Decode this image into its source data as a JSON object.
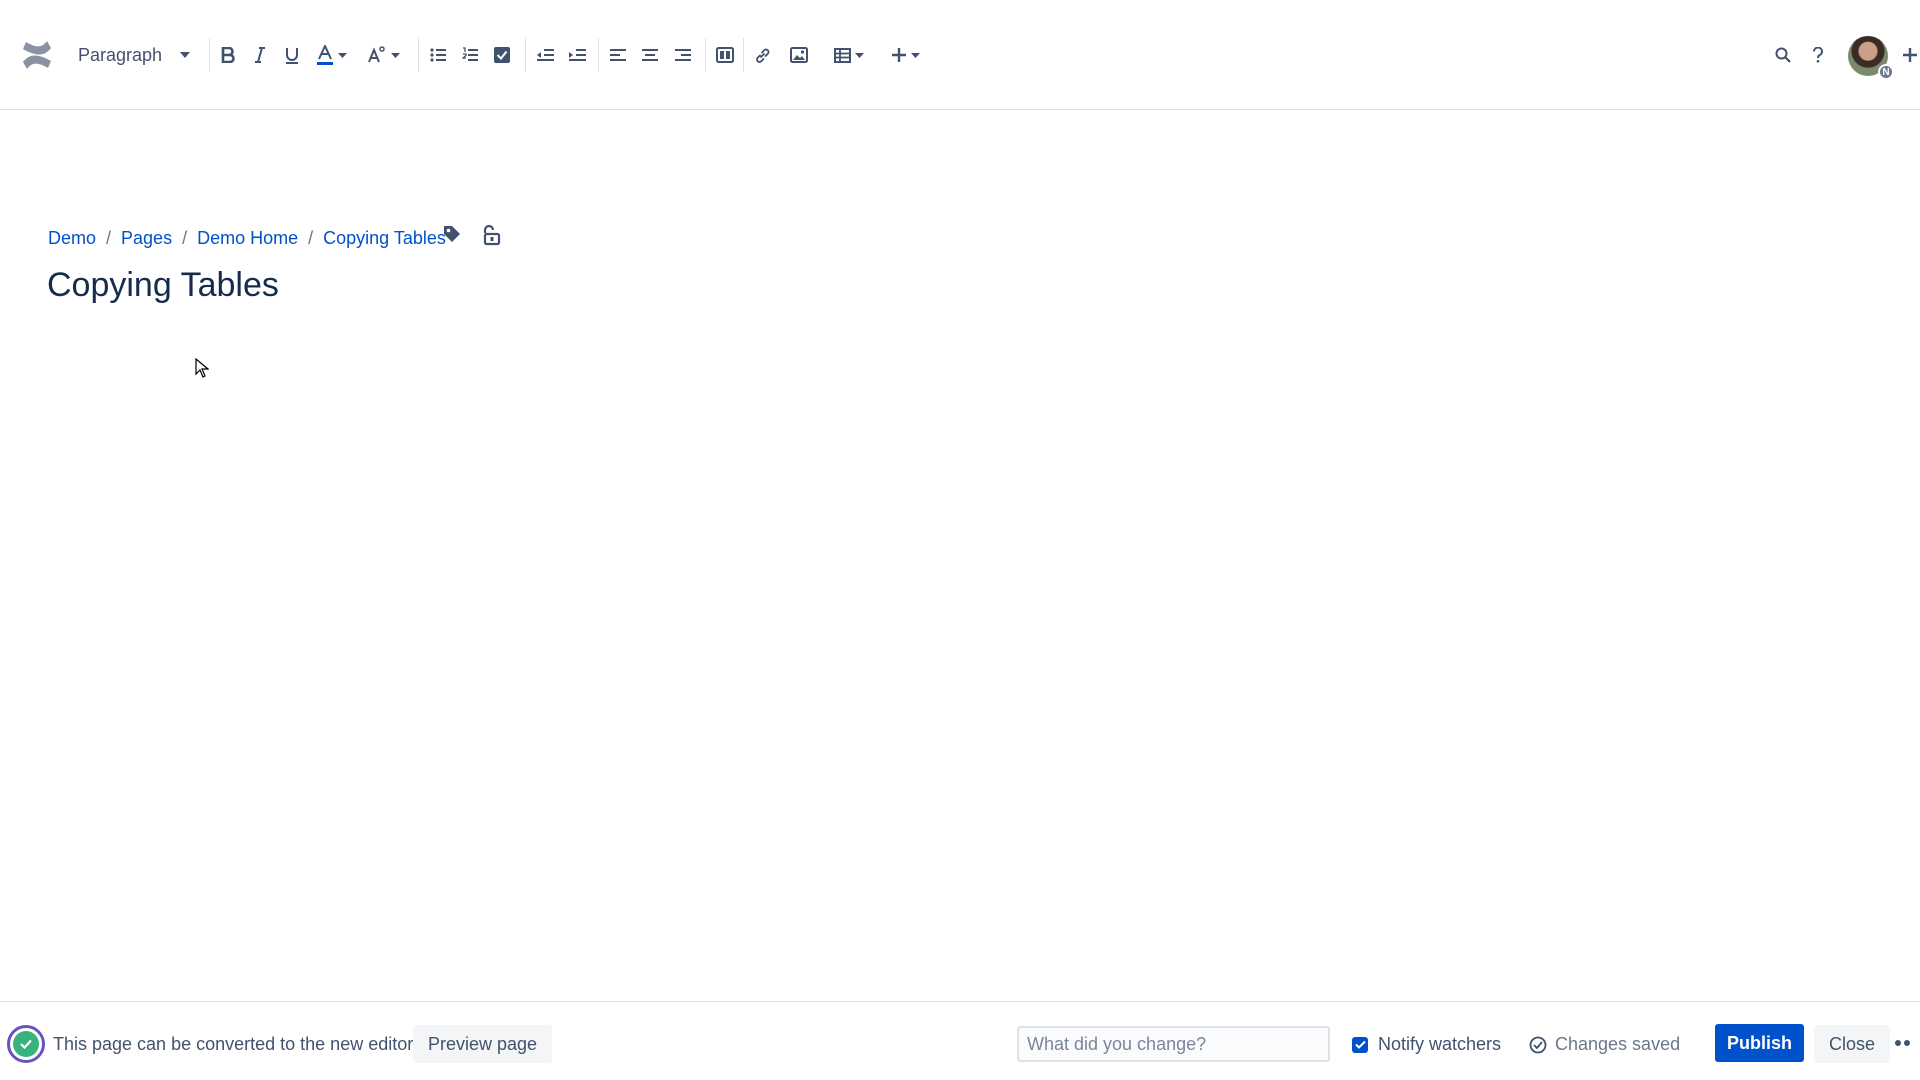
{
  "toolbar": {
    "paragraph_style": "Paragraph",
    "buttons": [
      "bold",
      "italic",
      "underline",
      "text-color",
      "text-style",
      "bullet-list",
      "numbered-list",
      "task-list",
      "outdent",
      "indent",
      "align-left",
      "align-center",
      "align-right",
      "page-layout",
      "link",
      "image",
      "table",
      "insert-more"
    ],
    "right": [
      "search",
      "help",
      "avatar",
      "create"
    ],
    "avatar_badge": "N"
  },
  "breadcrumb": {
    "items": [
      "Demo",
      "Pages",
      "Demo Home",
      "Copying Tables"
    ],
    "separator": "/"
  },
  "page": {
    "title": "Copying Tables"
  },
  "footer": {
    "convert_text": "This page can be converted to the new editor",
    "preview_label": "Preview page",
    "change_placeholder": "What did you change?",
    "notify_label": "Notify watchers",
    "notify_checked": true,
    "status_text": "Changes saved",
    "publish_label": "Publish",
    "close_label": "Close"
  },
  "colors": {
    "accent": "#0052cc",
    "text": "#172b4d",
    "icon": "#42526e",
    "border": "#dfe1e6",
    "convert_ring": "#6554c0",
    "convert_check": "#36b37e"
  }
}
